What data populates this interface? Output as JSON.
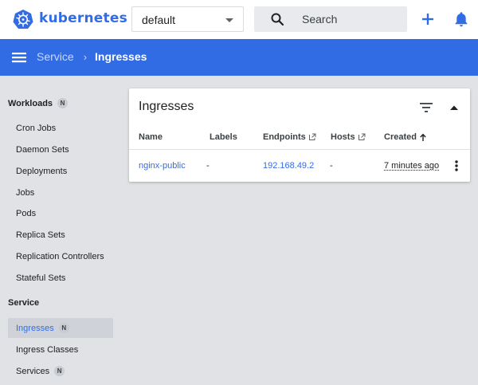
{
  "header": {
    "brand": "kubernetes",
    "namespace": "default",
    "search_placeholder": "Search"
  },
  "breadcrumb": {
    "parent": "Service",
    "separator": "›",
    "current": "Ingresses"
  },
  "sidebar": {
    "sections": [
      {
        "title": "Workloads",
        "badge": "N",
        "items": [
          {
            "label": "Cron Jobs"
          },
          {
            "label": "Daemon Sets"
          },
          {
            "label": "Deployments"
          },
          {
            "label": "Jobs"
          },
          {
            "label": "Pods"
          },
          {
            "label": "Replica Sets"
          },
          {
            "label": "Replication Controllers"
          },
          {
            "label": "Stateful Sets"
          }
        ]
      },
      {
        "title": "Service",
        "items": [
          {
            "label": "Ingresses",
            "badge": "N",
            "active": true
          },
          {
            "label": "Ingress Classes"
          },
          {
            "label": "Services",
            "badge": "N"
          }
        ]
      }
    ]
  },
  "card": {
    "title": "Ingresses",
    "columns": [
      "Name",
      "Labels",
      "Endpoints",
      "Hosts",
      "Created"
    ],
    "rows": [
      {
        "name": "nginx-public",
        "labels": "-",
        "endpoints": "192.168.49.2",
        "hosts": "-",
        "created": "7 minutes ago"
      }
    ]
  },
  "colors": {
    "accent": "#326ce5",
    "background": "#e0e2e5"
  }
}
